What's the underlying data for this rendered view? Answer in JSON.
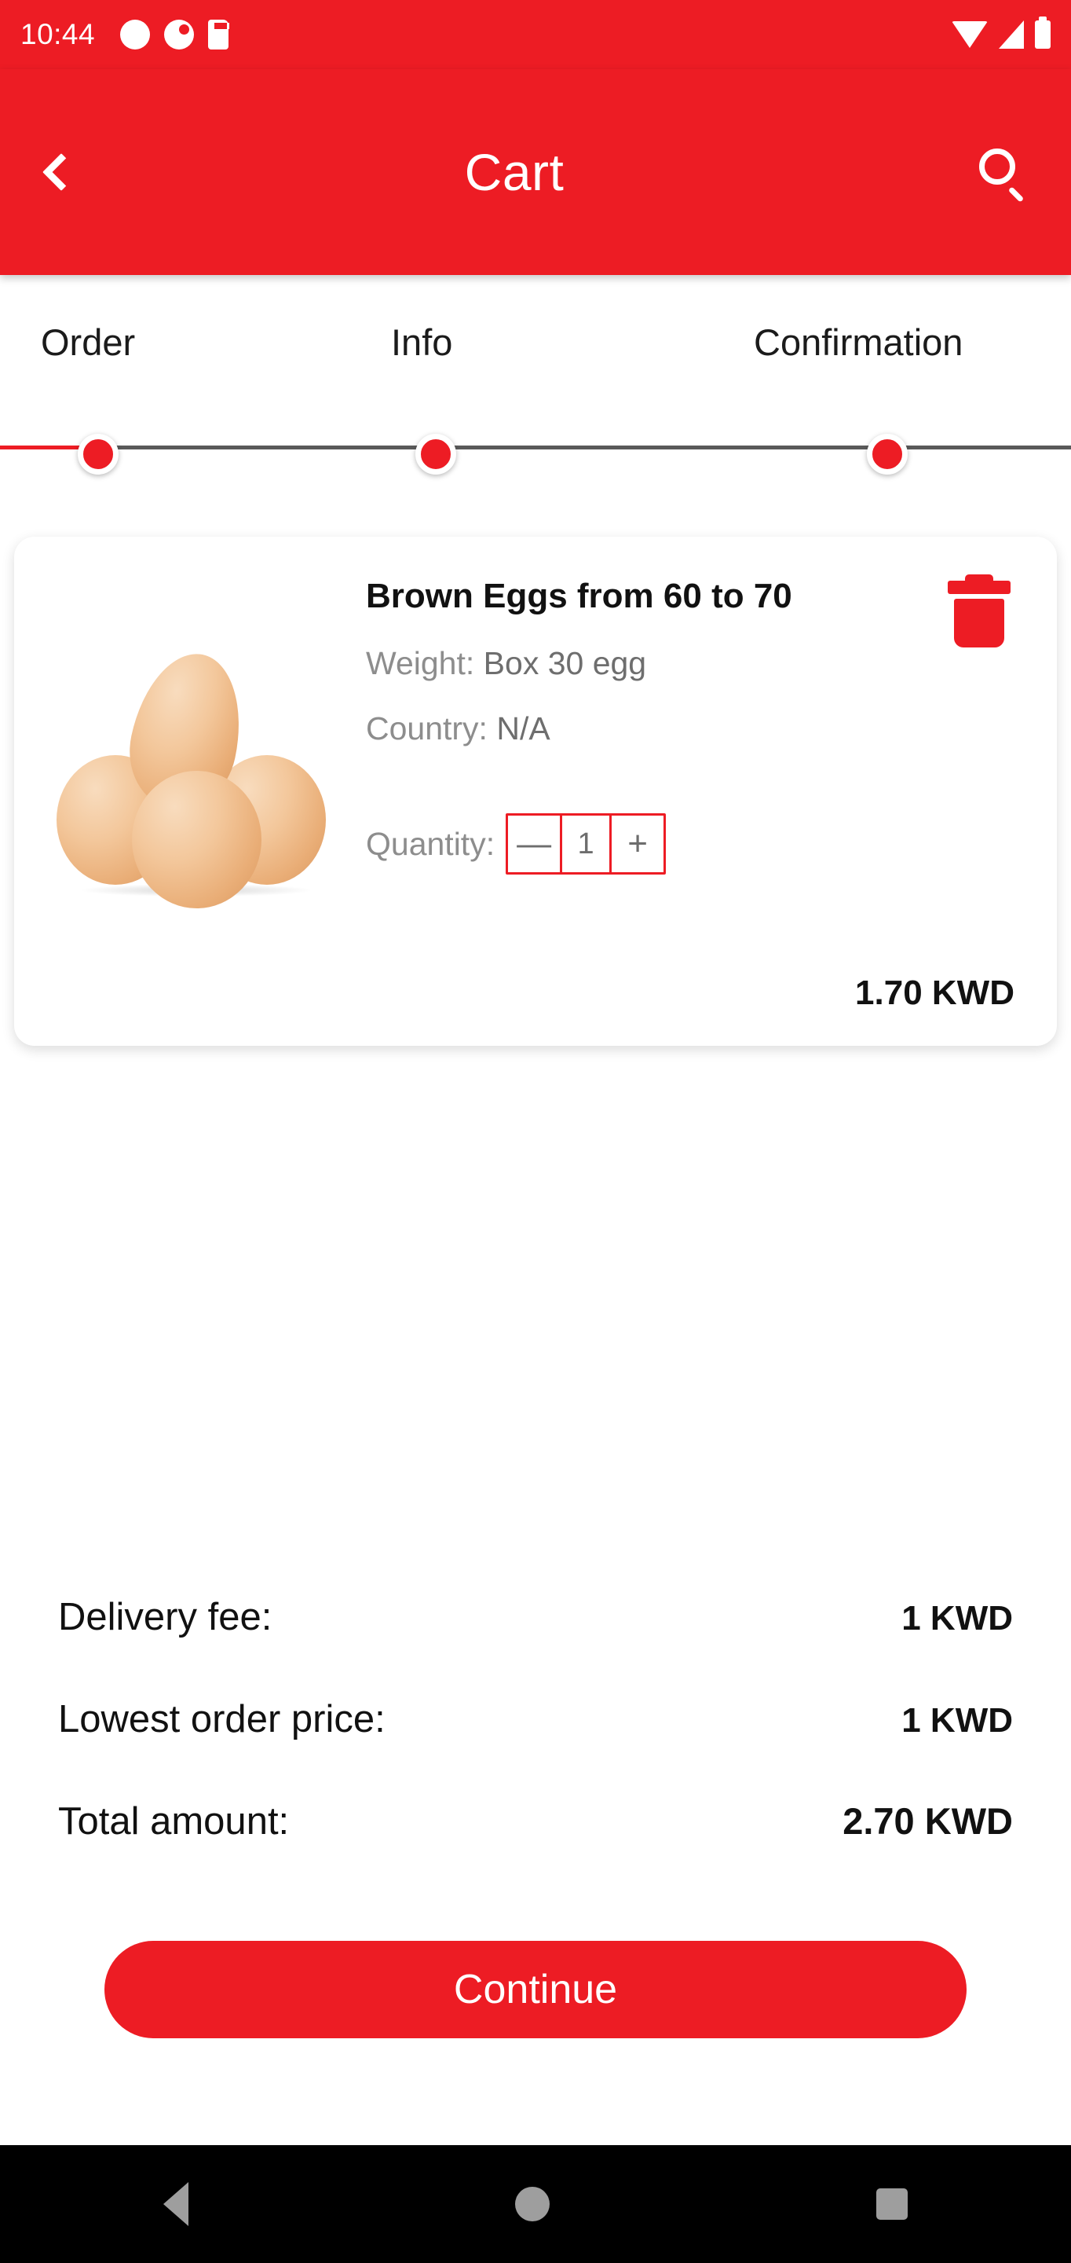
{
  "status_bar": {
    "time": "10:44",
    "left_icons": [
      "circle-icon",
      "clock-icon",
      "sd-card-icon"
    ],
    "right_icons": [
      "wifi-icon",
      "cellular-signal-icon",
      "battery-icon"
    ]
  },
  "app_bar": {
    "title": "Cart",
    "back_icon": "chevron-left-icon",
    "search_icon": "search-icon"
  },
  "stepper": {
    "steps": [
      {
        "label": "Order"
      },
      {
        "label": "Info"
      },
      {
        "label": "Confirmation"
      }
    ]
  },
  "cart_item": {
    "title": "Brown Eggs from 60 to 70",
    "weight_label": "Weight:",
    "weight_value": "Box 30 egg",
    "country_label": "Country:",
    "country_value": "N/A",
    "quantity_label": "Quantity:",
    "quantity_value": "1",
    "decrement_label": "—",
    "increment_label": "+",
    "price": "1.70 KWD",
    "delete_icon": "trash-icon",
    "image_alt": "brown-eggs-photo"
  },
  "summary": {
    "rows": [
      {
        "label": "Delivery fee:",
        "value": "1 KWD"
      },
      {
        "label": "Lowest order price:",
        "value": "1 KWD"
      },
      {
        "label": "Total amount:",
        "value": "2.70 KWD"
      }
    ]
  },
  "actions": {
    "continue_label": "Continue"
  },
  "nav_bar": {
    "back_icon": "triangle-back-icon",
    "home_icon": "circle-home-icon",
    "recents_icon": "square-recents-icon"
  },
  "colors": {
    "brand_red": "#ED1C24",
    "text_dark": "#111111",
    "text_muted": "#8D8D8D",
    "nav_bar_bg": "#000000",
    "nav_icon": "#9E9E9E"
  }
}
